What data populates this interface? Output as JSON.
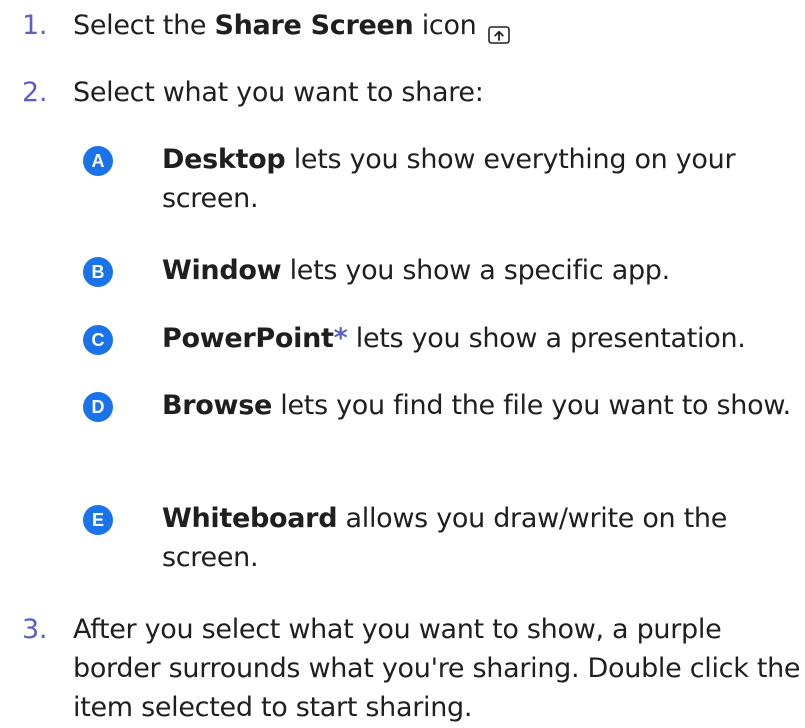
{
  "steps": [
    {
      "num": "1.",
      "pre": "Select the ",
      "bold": "Share Screen",
      "post": " icon"
    },
    {
      "num": "2.",
      "text": "Select what you want to share:"
    },
    {
      "num": "3.",
      "text": "After you select what you want to show, a purple border surrounds what you're sharing. Double click the item selected to start sharing."
    }
  ],
  "options": [
    {
      "letter": "A",
      "bold": "Desktop",
      "rest": " lets you show everything on your screen."
    },
    {
      "letter": "B",
      "bold": "Window",
      "rest": " lets you show a specific app."
    },
    {
      "letter": "C",
      "bold": "PowerPoint",
      "asterisk": "*",
      "rest": " lets you show a presentation."
    },
    {
      "letter": "D",
      "bold": "Browse",
      "rest": " lets you find the file you want to show."
    },
    {
      "letter": "E",
      "bold": "Whiteboard",
      "rest": " allows you draw/write on the screen."
    }
  ],
  "colors": {
    "number": "#5b5fc7",
    "badge": "#1a73e8",
    "text": "#1f1f1f"
  },
  "icons": {
    "share": "share-screen-icon"
  }
}
